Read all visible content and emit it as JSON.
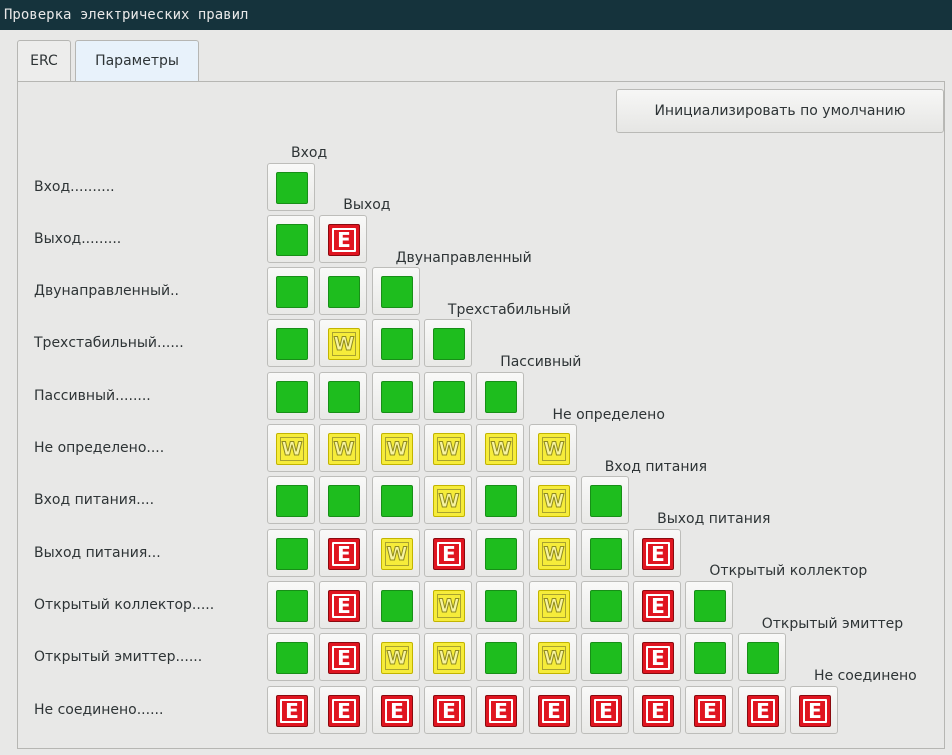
{
  "window": {
    "title": "Проверка электрических правил"
  },
  "tabs": [
    {
      "label": "ERC",
      "active": false
    },
    {
      "label": "Параметры",
      "active": true
    }
  ],
  "reset_button": {
    "label": "Инициализировать по умолчанию"
  },
  "pin_types": [
    {
      "row_label": "Вход..........",
      "col_label": "Вход"
    },
    {
      "row_label": "Выход.........",
      "col_label": "Выход"
    },
    {
      "row_label": "Двунаправленный..",
      "col_label": "Двунаправленный"
    },
    {
      "row_label": "Трехстабильный......",
      "col_label": "Трехстабильный"
    },
    {
      "row_label": "Пассивный........",
      "col_label": "Пассивный"
    },
    {
      "row_label": "Не определено....",
      "col_label": "Не определено"
    },
    {
      "row_label": "Вход питания....",
      "col_label": "Вход питания"
    },
    {
      "row_label": "Выход питания...",
      "col_label": "Выход питания"
    },
    {
      "row_label": "Открытый коллектор.....",
      "col_label": "Открытый коллектор"
    },
    {
      "row_label": "Открытый эмиттер......",
      "col_label": "Открытый эмиттер"
    },
    {
      "row_label": "Не соединено......",
      "col_label": "Не соединено"
    }
  ],
  "markers": {
    "ok": "",
    "warning": "W",
    "error": "E"
  },
  "colors": {
    "ok": "#1ebd1e",
    "warning": "#f6ec3a",
    "error": "#e01520",
    "titlebar": "#15333c"
  },
  "matrix": [
    [
      "ok"
    ],
    [
      "ok",
      "error"
    ],
    [
      "ok",
      "ok",
      "ok"
    ],
    [
      "ok",
      "warning",
      "ok",
      "ok"
    ],
    [
      "ok",
      "ok",
      "ok",
      "ok",
      "ok"
    ],
    [
      "warning",
      "warning",
      "warning",
      "warning",
      "warning",
      "warning"
    ],
    [
      "ok",
      "ok",
      "ok",
      "warning",
      "ok",
      "warning",
      "ok"
    ],
    [
      "ok",
      "error",
      "warning",
      "error",
      "ok",
      "warning",
      "ok",
      "error"
    ],
    [
      "ok",
      "error",
      "ok",
      "warning",
      "ok",
      "warning",
      "ok",
      "error",
      "ok"
    ],
    [
      "ok",
      "error",
      "warning",
      "warning",
      "ok",
      "warning",
      "ok",
      "error",
      "ok",
      "ok"
    ],
    [
      "error",
      "error",
      "error",
      "error",
      "error",
      "error",
      "error",
      "error",
      "error",
      "error",
      "error"
    ]
  ]
}
